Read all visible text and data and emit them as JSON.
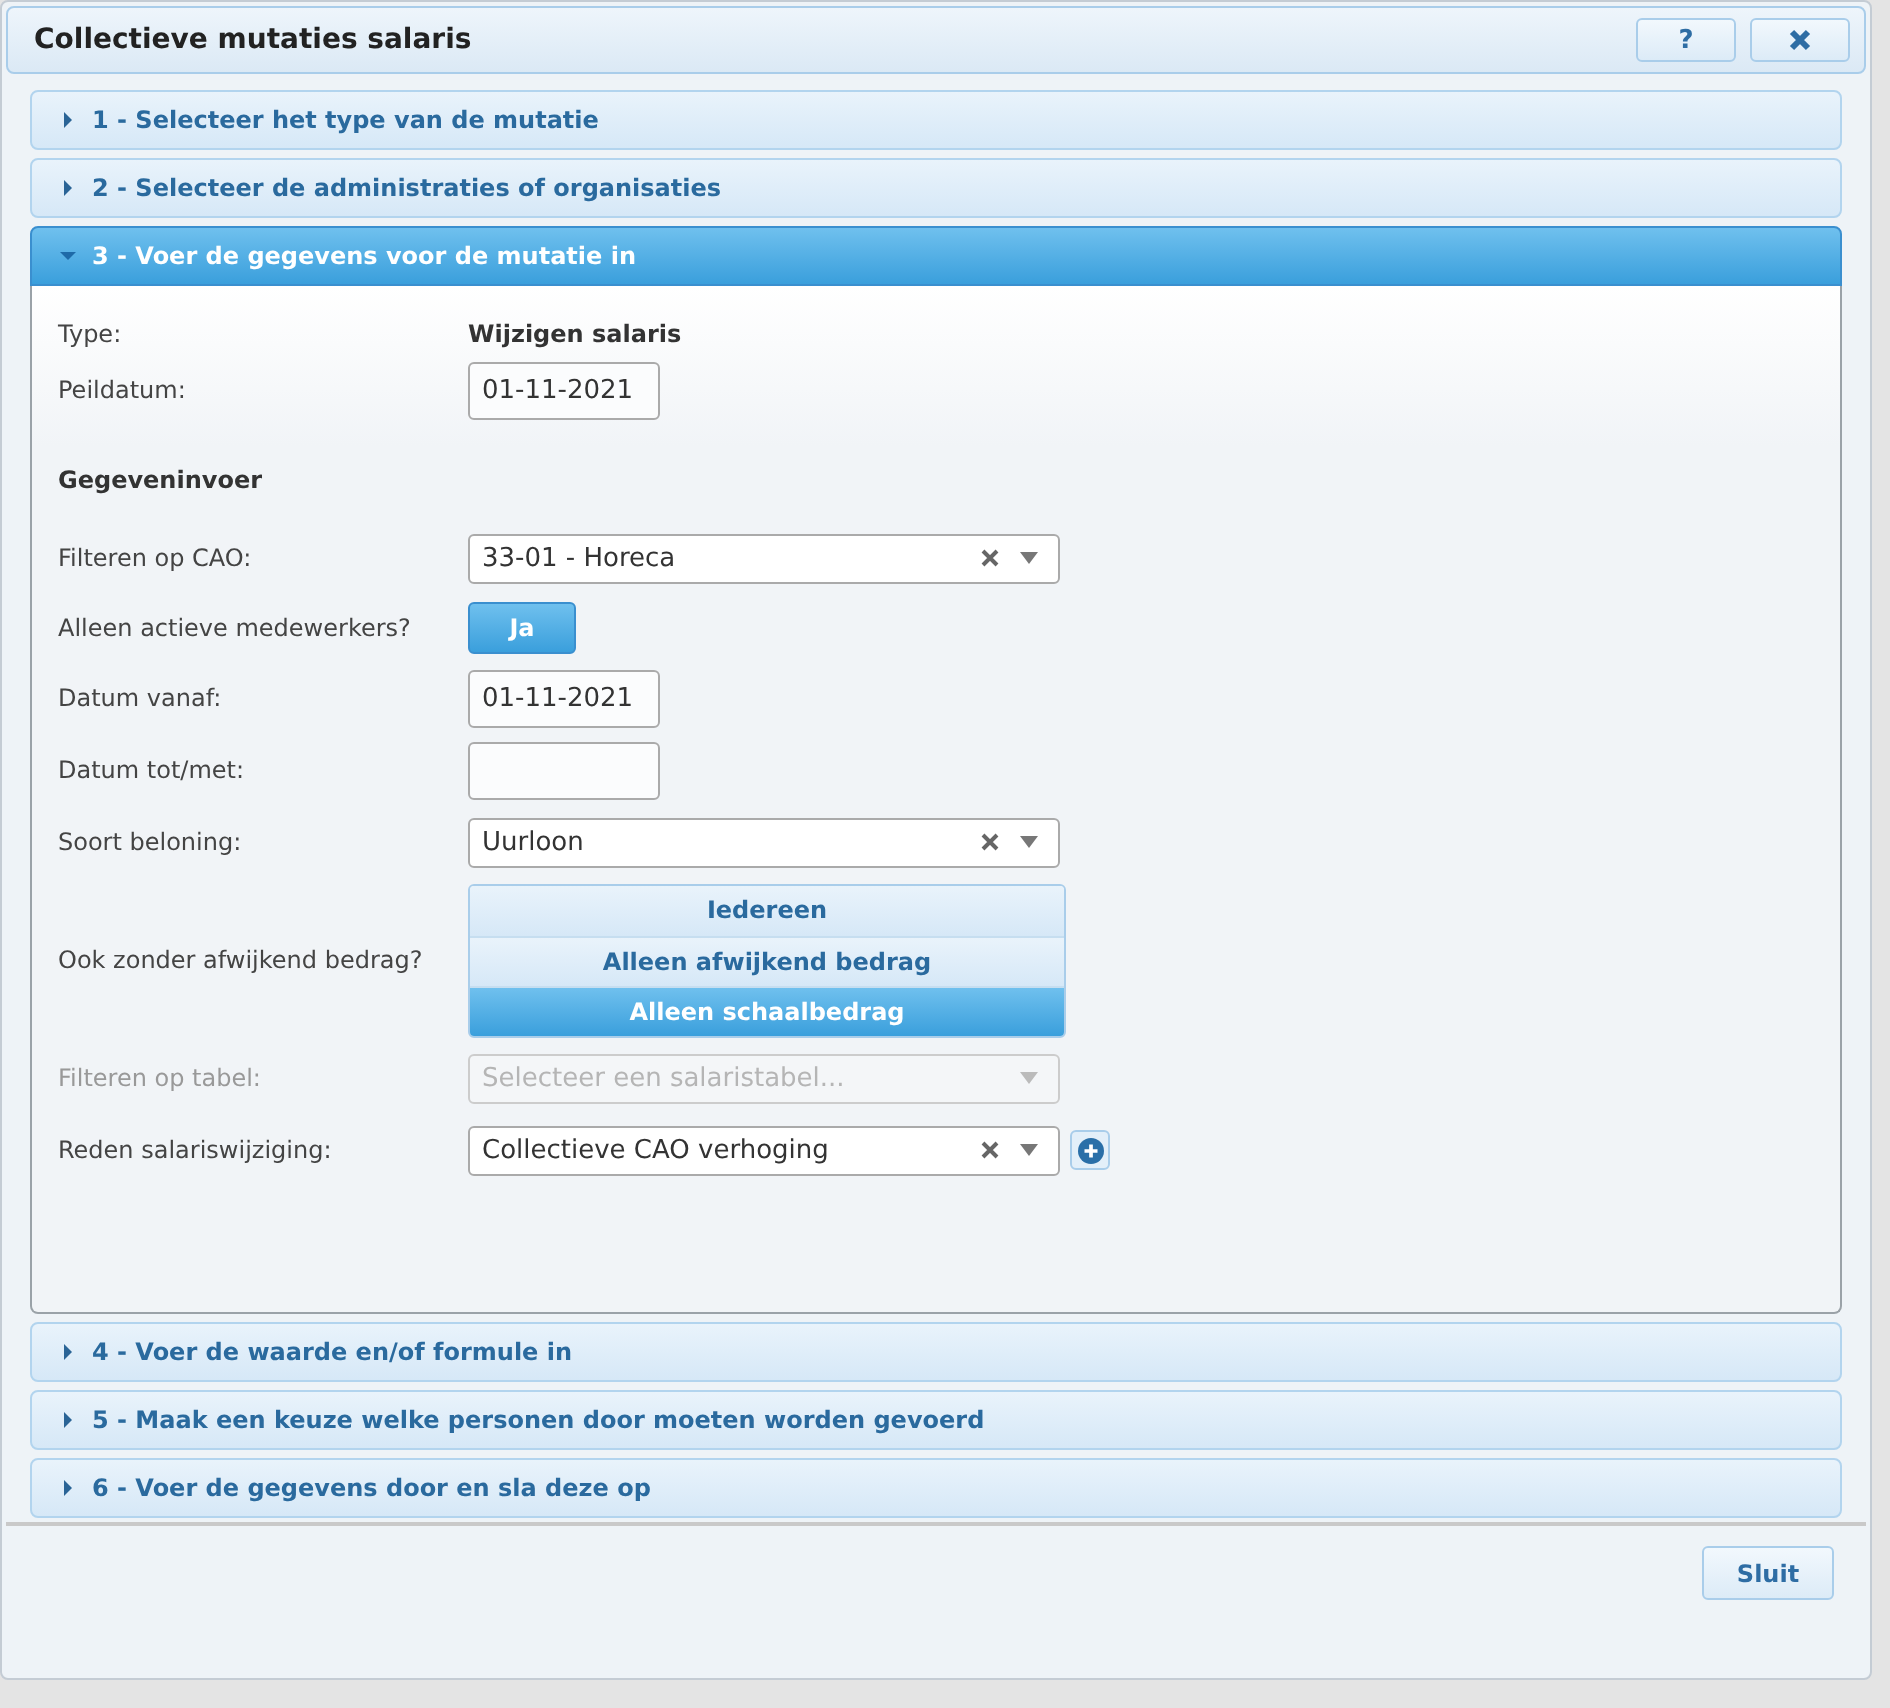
{
  "window": {
    "title": "Collectieve mutaties salaris",
    "help_button": "?"
  },
  "sections": [
    {
      "label": "1 - Selecteer het type van de mutatie",
      "expanded": false
    },
    {
      "label": "2 - Selecteer de administraties of organisaties",
      "expanded": false
    },
    {
      "label": "3 - Voer de gegevens voor de mutatie in",
      "expanded": true,
      "form": [
        {
          "kind": "text",
          "label": "Type:",
          "value": "Wijzigen salaris"
        },
        {
          "kind": "date",
          "label": "Peildatum:",
          "value": "01-11-2021"
        },
        {
          "kind": "heading",
          "label": "Gegeveninvoer"
        },
        {
          "kind": "select",
          "label": "Filteren op CAO:",
          "value": "33-01 - Horeca",
          "disabled": false
        },
        {
          "kind": "toggle",
          "label": "Alleen actieve medewerkers?",
          "value": "Ja",
          "on": true
        },
        {
          "kind": "date",
          "label": "Datum vanaf:",
          "value": "01-11-2021"
        },
        {
          "kind": "date",
          "label": "Datum tot/met:"
        },
        {
          "kind": "select",
          "label": "Soort beloning:",
          "value": "Uurloon",
          "disabled": false
        },
        {
          "kind": "segmented",
          "label": "Ook zonder afwijkend bedrag?",
          "options": [
            {
              "label": "Iedereen",
              "selected": false
            },
            {
              "label": "Alleen afwijkend bedrag",
              "selected": false
            },
            {
              "label": "Alleen schaalbedrag",
              "selected": true
            }
          ]
        },
        {
          "kind": "select",
          "label": "Filteren op tabel:",
          "placeholder": "Selecteer een salaristabel...",
          "disabled": true
        },
        {
          "kind": "select",
          "label": "Reden salariswijziging:",
          "value": "Collectieve CAO verhoging",
          "disabled": false,
          "add": true
        }
      ]
    },
    {
      "label": "4 - Voer de waarde en/of formule in",
      "expanded": false
    },
    {
      "label": "5 - Maak een keuze welke personen door moeten worden gevoerd",
      "expanded": false
    },
    {
      "label": "6 - Voer de gegevens door en sla deze op",
      "expanded": false
    }
  ],
  "footer": {
    "close_button": "Sluit"
  }
}
